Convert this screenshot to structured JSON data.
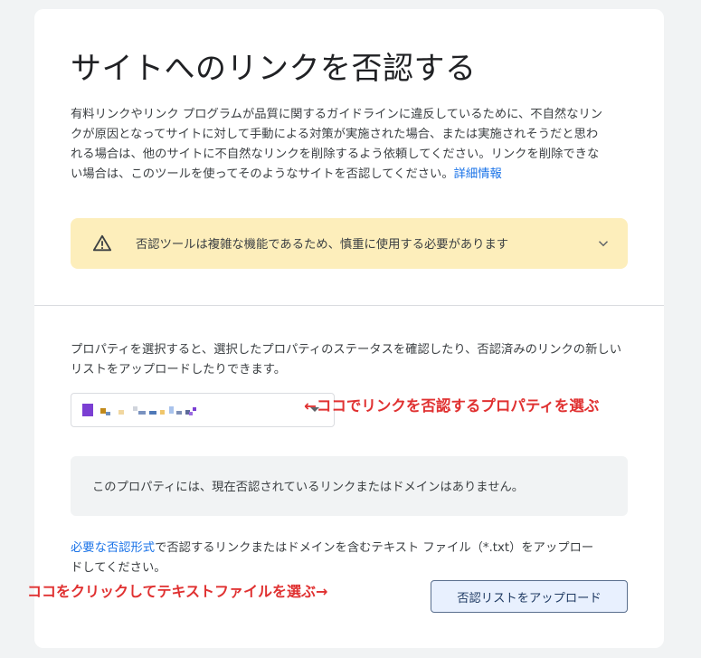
{
  "page": {
    "title": "サイトへのリンクを否認する",
    "intro_text": "有料リンクやリンク プログラムが品質に関するガイドラインに違反しているために、不自然なリンクが原因となってサイトに対して手動による対策が実施された場合、または実施されそうだと思われる場合は、他のサイトに不自然なリンクを削除するよう依頼してください。リンクを削除できない場合は、このツールを使ってそのようなサイトを否認してください。",
    "learn_more_link": "詳細情報"
  },
  "warning": {
    "text": "否認ツールは複雑な機能であるため、慎重に使用する必要があります",
    "icon": "warning-triangle-icon",
    "expand_icon": "chevron-down-icon",
    "background": "#fdeebb"
  },
  "property": {
    "description": "プロパティを選択すると、選択したプロパティのステータスを確認したり、否認済みのリンクの新しいリストをアップロードしたりできます。",
    "selector_icon": "chevron-down-icon",
    "empty_message": "このプロパティには、現在否認されているリンクまたはドメインはありません。"
  },
  "upload": {
    "format_link": "必要な否認形式",
    "description_rest": "で否認するリンクまたはドメインを含むテキスト ファイル（*.txt）をアップロードしてください。",
    "button_label": "否認リストをアップロード"
  },
  "annotations": {
    "select_property": "←ココでリンクを否認するプロパティを選ぶ",
    "click_upload": "ココをクリックしてテキストファイルを選ぶ→",
    "color": "#e03131"
  },
  "colors": {
    "link": "#1a73e8",
    "favicon": "#7b3fd3"
  }
}
